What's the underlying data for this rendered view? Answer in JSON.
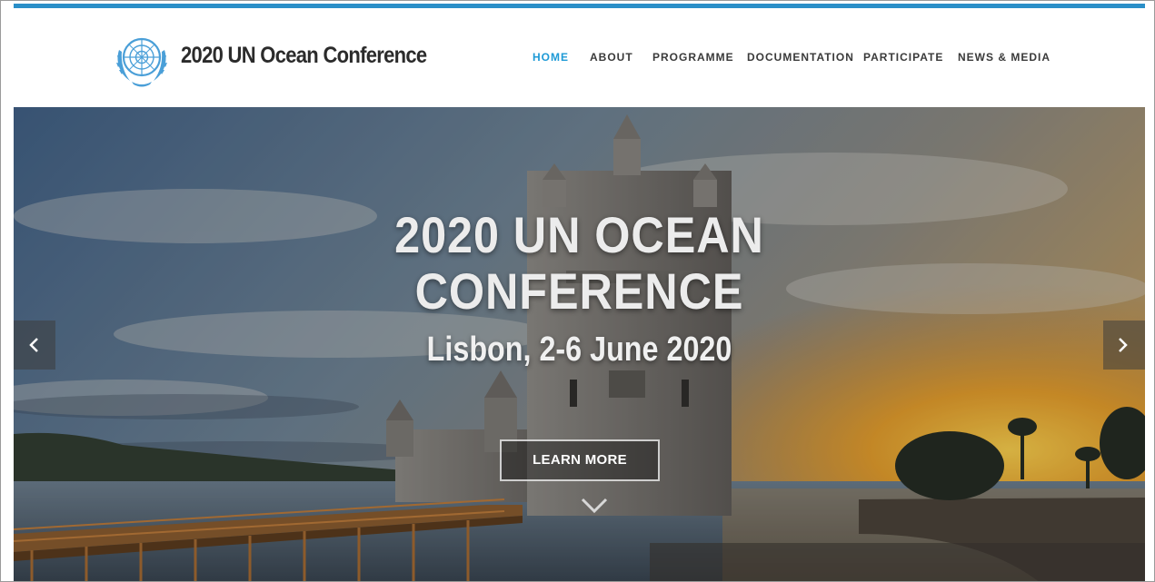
{
  "header": {
    "site_title": "2020 UN Ocean Conference",
    "logo": "un-emblem-icon"
  },
  "nav": {
    "items": [
      {
        "label": "HOME",
        "active": true
      },
      {
        "label": "ABOUT",
        "active": false
      },
      {
        "label": "PROGRAMME",
        "active": false
      },
      {
        "label": "DOCUMENTATION",
        "active": false
      },
      {
        "label": "PARTICIPATE",
        "active": false
      },
      {
        "label": "NEWS & MEDIA",
        "active": false
      }
    ]
  },
  "hero": {
    "title_line1": "2020 UN OCEAN",
    "title_line2": "CONFERENCE",
    "subtitle": "Lisbon, 2-6 June 2020",
    "cta_label": "LEARN MORE",
    "prev_icon": "chevron-left-icon",
    "next_icon": "chevron-right-icon",
    "scroll_icon": "chevron-down-icon"
  },
  "colors": {
    "accent": "#1e9ad6",
    "top_border": "#2a8fc8",
    "nav_text": "#3a3a3a"
  }
}
